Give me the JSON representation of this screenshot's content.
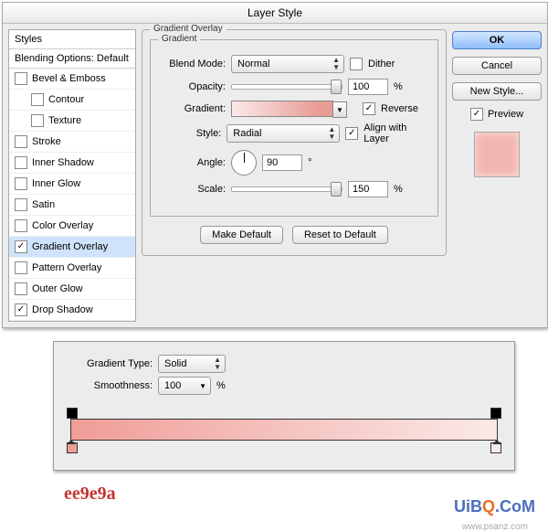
{
  "dialog": {
    "title": "Layer Style",
    "styles_header": "Styles",
    "blending_options": "Blending Options: Default",
    "items": [
      {
        "label": "Bevel & Emboss",
        "checked": false
      },
      {
        "label": "Contour",
        "checked": false,
        "indent": true
      },
      {
        "label": "Texture",
        "checked": false,
        "indent": true
      },
      {
        "label": "Stroke",
        "checked": false
      },
      {
        "label": "Inner Shadow",
        "checked": false
      },
      {
        "label": "Inner Glow",
        "checked": false
      },
      {
        "label": "Satin",
        "checked": false
      },
      {
        "label": "Color Overlay",
        "checked": false
      },
      {
        "label": "Gradient Overlay",
        "checked": true,
        "selected": true
      },
      {
        "label": "Pattern Overlay",
        "checked": false
      },
      {
        "label": "Outer Glow",
        "checked": false
      },
      {
        "label": "Drop Shadow",
        "checked": true
      }
    ]
  },
  "panel": {
    "section_label": "Gradient Overlay",
    "gradient_label": "Gradient",
    "blend_mode_label": "Blend Mode:",
    "blend_mode_value": "Normal",
    "dither_label": "Dither",
    "dither_checked": false,
    "opacity_label": "Opacity:",
    "opacity_value": "100",
    "opacity_unit": "%",
    "gradient_fieldlabel": "Gradient:",
    "reverse_label": "Reverse",
    "reverse_checked": true,
    "style_label": "Style:",
    "style_value": "Radial",
    "align_label": "Align with Layer",
    "align_checked": true,
    "angle_label": "Angle:",
    "angle_value": "90",
    "angle_unit": "°",
    "scale_label": "Scale:",
    "scale_value": "150",
    "scale_unit": "%",
    "make_default": "Make Default",
    "reset_default": "Reset to Default"
  },
  "right": {
    "ok": "OK",
    "cancel": "Cancel",
    "new_style": "New Style...",
    "preview_label": "Preview",
    "preview_checked": true
  },
  "grad_editor": {
    "type_label": "Gradient Type:",
    "type_value": "Solid",
    "smooth_label": "Smoothness:",
    "smooth_value": "100",
    "smooth_unit": "%"
  },
  "footer": {
    "hex": "ee9e9a",
    "watermark_u": "Ui",
    "watermark_b": "B",
    "watermark_q": "Q",
    "watermark_com": ".CoM",
    "wm2": "www.psanz.com"
  },
  "chart_data": {
    "type": "table",
    "title": "Gradient Overlay settings",
    "rows": [
      {
        "field": "Blend Mode",
        "value": "Normal"
      },
      {
        "field": "Dither",
        "value": false
      },
      {
        "field": "Opacity (%)",
        "value": 100
      },
      {
        "field": "Reverse",
        "value": true
      },
      {
        "field": "Style",
        "value": "Radial"
      },
      {
        "field": "Align with Layer",
        "value": true
      },
      {
        "field": "Angle (deg)",
        "value": 90
      },
      {
        "field": "Scale (%)",
        "value": 150
      },
      {
        "field": "Gradient Type",
        "value": "Solid"
      },
      {
        "field": "Smoothness (%)",
        "value": 100
      },
      {
        "field": "Gradient right stop hex",
        "value": "ee9e9a"
      }
    ]
  }
}
